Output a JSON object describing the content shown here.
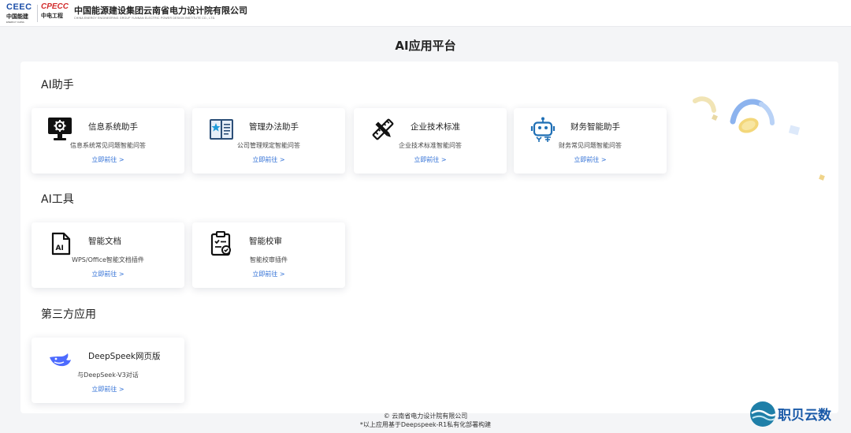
{
  "header": {
    "logo_ceec_mark": "CEEC",
    "logo_ceec_cn": "中国能建",
    "logo_ceec_en": "ENERGY CHINA",
    "logo_cpecc_mark": "CPECC",
    "logo_cpecc_cn": "中电工程",
    "company_cn": "中国能源建设集团云南省电力设计院有限公司",
    "company_en": "CHINA ENERGY ENGINEERING GROUP YUNNAN ELECTRIC POWER DESIGN INSTITUTE CO., LTD."
  },
  "page_title": "AI应用平台",
  "sections": [
    {
      "title": "AI助手",
      "cards": [
        {
          "name": "信息系统助手",
          "desc": "信息系统常见问题智能问答",
          "link": "立即前往 >",
          "icon": "monitor-gear-icon"
        },
        {
          "name": "管理办法助手",
          "desc": "公司管理规定智能问答",
          "link": "立即前往 >",
          "icon": "book-star-icon"
        },
        {
          "name": "企业技术标准",
          "desc": "企业技术标准智能问答",
          "link": "立即前往 >",
          "icon": "ruler-pencil-icon"
        },
        {
          "name": "财务智能助手",
          "desc": "财务常见问题智能问答",
          "link": "立即前往 >",
          "icon": "robot-icon"
        }
      ]
    },
    {
      "title": "AI工具",
      "cards": [
        {
          "name": "智能文档",
          "desc": "WPS/Office智能文档插件",
          "link": "立即前往 >",
          "icon": "ai-document-icon"
        },
        {
          "name": "智能校审",
          "desc": "智能校审插件",
          "link": "立即前往 >",
          "icon": "clipboard-check-icon"
        }
      ]
    },
    {
      "title": "第三方应用",
      "cards": [
        {
          "name": "DeepSpeek网页版",
          "desc": "与DeepSeek-V3对话",
          "link": "立即前往 >",
          "icon": "whale-icon"
        }
      ]
    }
  ],
  "footer": {
    "copyright": "© 云南省电力设计院有限公司",
    "note": "*以上应用基于Deepspeek-R1私有化部署构建"
  },
  "watermark": {
    "text": "职贝云数"
  },
  "colors": {
    "accent": "#2f6fd6",
    "brand_blue": "#1d4fa8",
    "brand_red": "#d22c2c"
  }
}
